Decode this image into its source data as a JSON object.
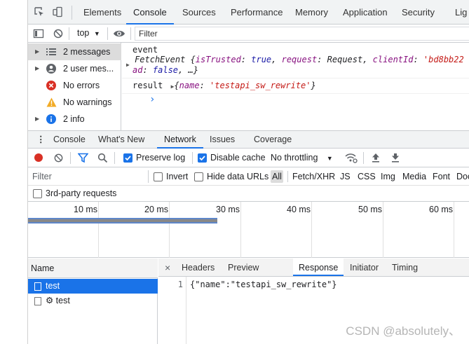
{
  "main_tabs": [
    "Elements",
    "Console",
    "Sources",
    "Performance",
    "Memory",
    "Application",
    "Security",
    "Lig"
  ],
  "console_toolbar": {
    "context": "top",
    "filter_placeholder": "Filter"
  },
  "console_sidebar": [
    {
      "label": "2 messages",
      "icon": "list-icon",
      "expandable": true,
      "selected": true
    },
    {
      "label": "2 user mes...",
      "icon": "user-icon",
      "expandable": true,
      "selected": false
    },
    {
      "label": "No errors",
      "icon": "error-icon",
      "expandable": false,
      "selected": false
    },
    {
      "label": "No warnings",
      "icon": "warning-icon",
      "expandable": false,
      "selected": false
    },
    {
      "label": "2 info",
      "icon": "info-icon",
      "expandable": true,
      "selected": false
    }
  ],
  "console_output": {
    "line1": "event",
    "fetch": {
      "name": "FetchEvent",
      "open": " {",
      "k1": "isTrusted",
      "v1": "true",
      "k2": "request",
      "v2": "Request",
      "k3": "clientId",
      "v3": "'bd8bb22",
      "k4": "ad",
      "v4": "false",
      "tail": ", …}"
    },
    "result": {
      "label": "result",
      "key": "name",
      "value": "'testapi_sw_rewrite'"
    },
    "prompt": "›"
  },
  "drawer_tabs": [
    "Console",
    "What's New",
    "Network",
    "Issues",
    "Coverage"
  ],
  "network_toolbar": {
    "preserve_log": "Preserve log",
    "disable_cache": "Disable cache",
    "throttling": "No throttling"
  },
  "network_filter": {
    "placeholder": "Filter",
    "invert": "Invert",
    "hide_data_urls": "Hide data URLs",
    "types": [
      "All",
      "Fetch/XHR",
      "JS",
      "CSS",
      "Img",
      "Media",
      "Font",
      "Doc"
    ]
  },
  "third_party": "3rd-party requests",
  "overview_ticks": [
    "10 ms",
    "20 ms",
    "30 ms",
    "40 ms",
    "50 ms",
    "60 ms"
  ],
  "request_list": {
    "header": "Name",
    "rows": [
      {
        "name": "test",
        "selected": true,
        "gear": false
      },
      {
        "name": "⚙ test",
        "selected": false,
        "gear": true
      }
    ]
  },
  "detail_tabs": [
    "Headers",
    "Preview",
    "Response",
    "Initiator",
    "Timing"
  ],
  "response": {
    "line_no": "1",
    "code": "{\"name\":\"testapi_sw_rewrite\"}"
  },
  "watermark": "CSDN @absolutely、"
}
